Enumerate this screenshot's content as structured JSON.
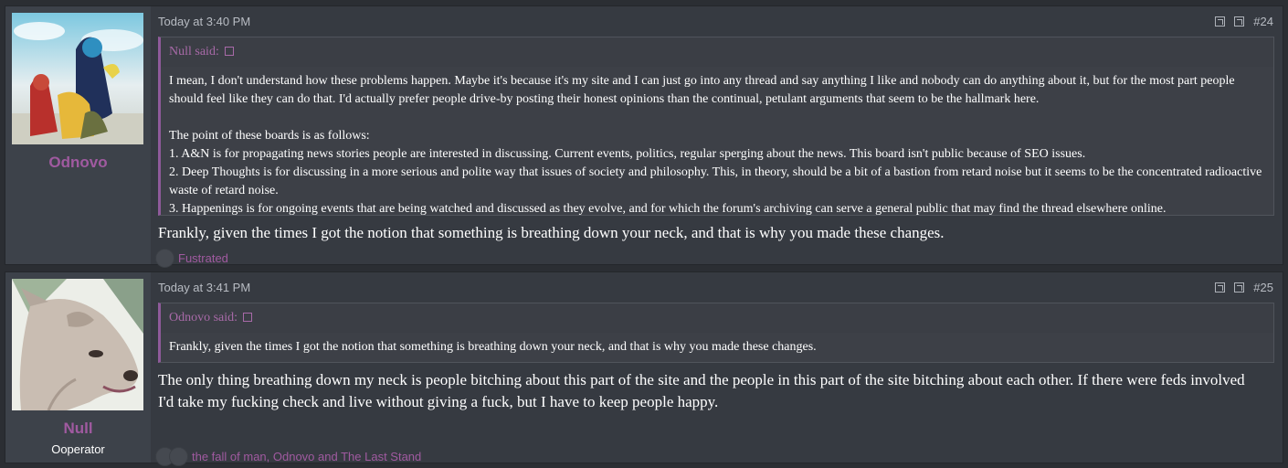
{
  "posts": [
    {
      "username": "Odnovo",
      "user_title": "",
      "date": "Today at 3:40 PM",
      "post_number": "#24",
      "quote": {
        "author": "Null said:",
        "paragraphs": [
          "I mean, I don't understand how these problems happen. Maybe it's because it's my site and I can just go into any thread and say anything I like and nobody can do anything about it, but for the most part people should feel like they can do that. I'd actually prefer people drive-by posting their honest opinions than the continual, petulant arguments that seem to be the hallmark here.",
          "",
          "The point of these boards is as follows:",
          "1. A&N is for propagating news stories people are interested in discussing. Current events, politics, regular sperging about the news. This board isn't public because of SEO issues.",
          "2. Deep Thoughts is for discussing in a more serious and polite way that issues of society and philosophy. This, in theory, should be a bit of a bastion from retard noise but it seems to be the concentrated radioactive waste of retard noise.",
          "3. Happenings is for ongoing events that are being watched and discussed as they evolve, and for which the forum's archiving can serve a general public that may find the thread elsewhere online."
        ]
      },
      "message": "Frankly, given the times I got the notion that something is breathing down your neck, and that is why you made these changes.",
      "likes": "Fustrated"
    },
    {
      "username": "Null",
      "user_title": "Ooperator",
      "date": "Today at 3:41 PM",
      "post_number": "#25",
      "quote": {
        "author": "Odnovo said:",
        "paragraphs": [
          "Frankly, given the times I got the notion that something is breathing down your neck, and that is why you made these changes."
        ]
      },
      "message": "The only thing breathing down my neck is people bitching about this part of the site and the people in this part of the site bitching about each other. If there were feds involved I'd take my fucking check and live without giving a fuck, but I have to keep people happy.",
      "likes": "the fall of man, Odnovo and The Last Stand"
    }
  ],
  "colors": {
    "accent": "#a05aa0",
    "background": "#2b2e33",
    "post_bg": "#363a41",
    "text": "#ffffff"
  }
}
